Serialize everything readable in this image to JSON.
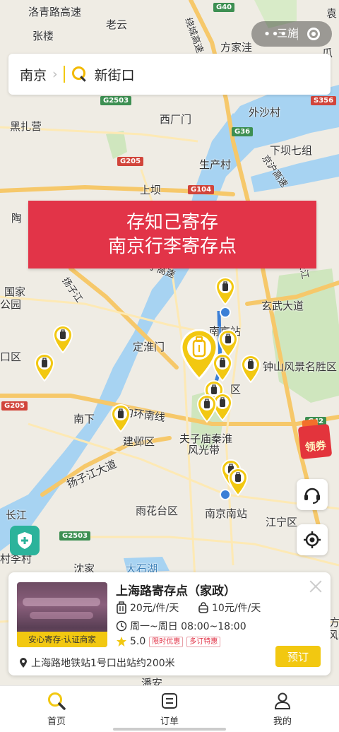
{
  "mini_program": {
    "label": "三施"
  },
  "search": {
    "city": "南京",
    "chevron": "›",
    "keyword": "新街口"
  },
  "banner": {
    "line1": "存知己寄存",
    "line2": "南京行李寄存点"
  },
  "map": {
    "labels": [
      "洛青路高速",
      "老云",
      "张楼",
      "方家洼",
      "黑扎营",
      "西厂门",
      "外沙村",
      "下坝七组",
      "生产村",
      "上坝",
      "陶",
      "国家",
      "公园",
      "口区",
      "南京站",
      "玄武大道",
      "定淮门",
      "钟山风景名胜区",
      "区",
      "南下",
      "内环南线",
      "建邺区",
      "夫子庙秦淮",
      "风光带",
      "扬子江大道",
      "长江",
      "雨花台区",
      "南京南站",
      "江宁区",
      "村李村",
      "沈家",
      "大石湖",
      "潘安",
      "袁",
      "瓜",
      "方",
      "风景",
      "扬子江",
      "长江",
      "京沪高速",
      "绕城高速",
      "宁高速"
    ],
    "badges": [
      "G40",
      "G2503",
      "S356",
      "G36",
      "G205",
      "G104",
      "G205",
      "G42",
      "G2503"
    ]
  },
  "floating": {
    "coupon_label": "领券"
  },
  "store": {
    "title": "上海路寄存点（家政）",
    "thumb_badge": "安心寄存·认证商家",
    "price_large": "20元/件/天",
    "price_small": "10元/件/天",
    "hours": "周一~周日 08:00~18:00",
    "rating": "5.0",
    "tags": [
      "限时优惠",
      "多订特惠"
    ],
    "address": "上海路地铁站1号口出站约200米",
    "book_label": "预订"
  },
  "tabs": [
    {
      "label": "首页",
      "icon": "search-icon"
    },
    {
      "label": "订单",
      "icon": "order-icon"
    },
    {
      "label": "我的",
      "icon": "user-icon"
    }
  ],
  "colors": {
    "accent": "#f2c811",
    "banner": "#e23448",
    "water": "#a7d3f2",
    "park": "#c8e6b4"
  }
}
